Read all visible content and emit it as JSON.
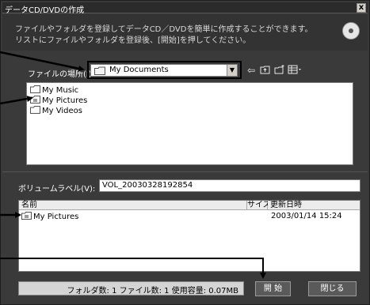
{
  "window": {
    "title": "データCD/DVDの作成",
    "close_label": "x"
  },
  "header": {
    "line1": "ファイルやフォルダを登録してデータCD／DVDを簡単に作成することができます。",
    "line2": "リストにファイルやフォルダを登録後、[開始]を押してください。",
    "icon": "cd-icon"
  },
  "location": {
    "label": "ファイルの場所(I):",
    "value": "My Documents",
    "toolbar_icons": [
      "back-icon",
      "up-folder-icon",
      "new-folder-icon",
      "view-menu-icon"
    ]
  },
  "files": [
    {
      "name": "My Music"
    },
    {
      "name": "My Pictures"
    },
    {
      "name": "My Videos"
    }
  ],
  "volume": {
    "label": "ボリュームラベル(V):",
    "value": "VOL_20030328192854"
  },
  "data_list": {
    "columns": [
      "名前",
      "サイズ",
      "更新日時"
    ],
    "rows": [
      {
        "name": "My Pictures",
        "size": "",
        "date": "2003/01/14 15:24"
      }
    ]
  },
  "status": "フォルダ数: 1 ファイル数: 1 使用容量: 0.07MB",
  "buttons": {
    "start": "開 始",
    "close": "閉じる"
  },
  "colors": {
    "window_bg": "#3a3a3a",
    "title_bg": "#2b2b2b",
    "list_bg": "#ffffff"
  }
}
